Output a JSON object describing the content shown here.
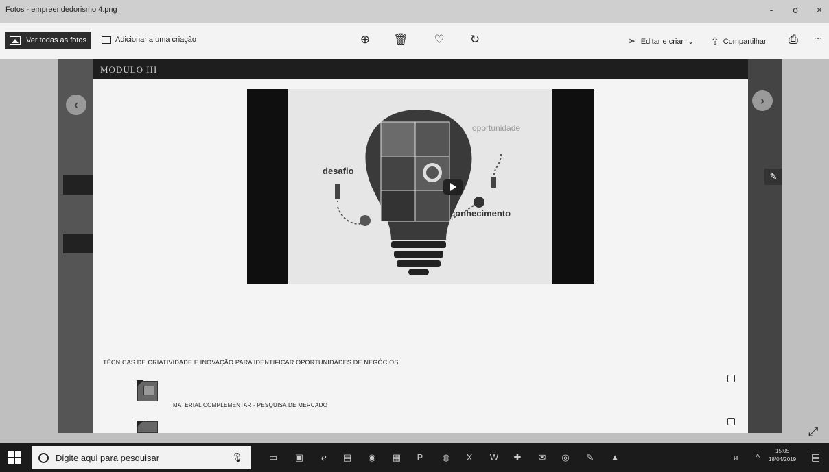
{
  "window": {
    "title": "Fotos - empreendedorismo 4.png",
    "controls": {
      "minimize": "-",
      "maximize": "o",
      "close": "×"
    }
  },
  "toolbar": {
    "see_all": "Ver todas as fotos",
    "add_to_creation": "Adicionar a uma criação",
    "zoom_icon": "⊕",
    "delete_icon": "🗑",
    "favorite_icon": "♡",
    "rotate_icon": "↻",
    "edit_create": "Editar e criar",
    "edit_chevron": "⌄",
    "share": "Compartilhar",
    "print_icon": "⎙",
    "more": "···"
  },
  "page": {
    "module_title": "MODULO III",
    "video": {
      "label_challenge": "desafio",
      "label_opportunity": "oportunidade",
      "label_knowledge": "conhecimento"
    },
    "lesson_title": "TÉCNICAS DE CRIATIVIDADE E INOVAÇÃO PARA IDENTIFICAR OPORTUNIDADES DE NEGÓCIOS",
    "material_title": "MATERIAL COMPLEMENTAR - PESQUISA DE MERCADO",
    "nav_prev": "‹",
    "nav_next": "›",
    "expand_icon": "⤢"
  },
  "taskbar": {
    "search_placeholder": "Digite aqui para pesquisar",
    "mic_icon": "🎙",
    "time": "15:05",
    "date": "18/04/2019"
  }
}
